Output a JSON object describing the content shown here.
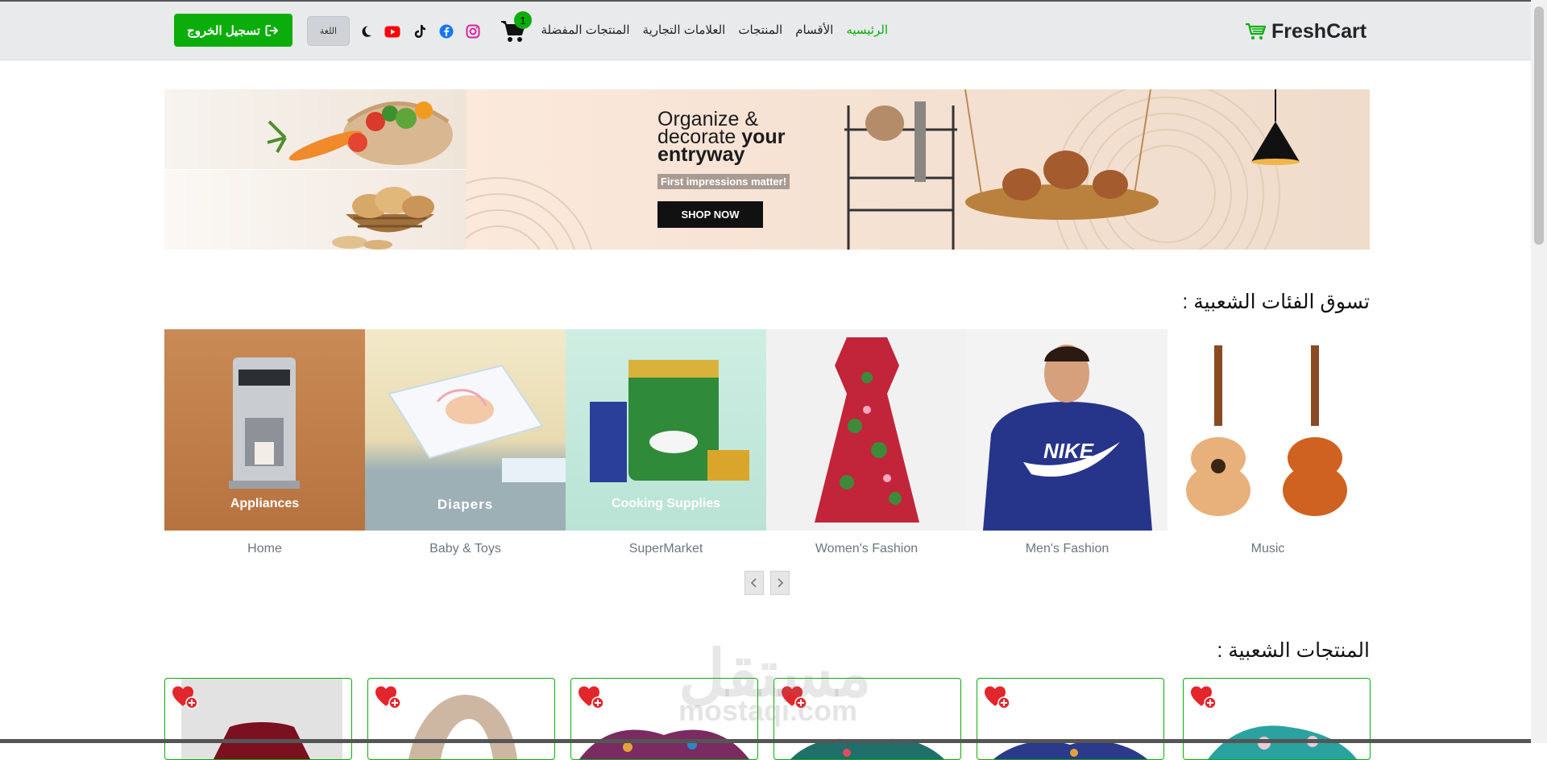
{
  "brand": {
    "name": "FreshCart",
    "icon": "cart-icon",
    "color": "#0aad0a"
  },
  "nav": {
    "links": [
      {
        "label": "الرئيسيه",
        "active": true
      },
      {
        "label": "الأقسام"
      },
      {
        "label": "المنتجات"
      },
      {
        "label": "العلامات التجارية"
      },
      {
        "label": "المنتجات المفضلة"
      }
    ],
    "cart_count": "1",
    "social_icons": [
      "instagram-icon",
      "facebook-icon",
      "tiktok-icon",
      "youtube-icon",
      "moon-icon"
    ],
    "language_label": "اللغة",
    "logout_label": "تسجيل الخروج"
  },
  "banner": {
    "title_line1": "Organize &",
    "title_line2a": "decorate",
    "title_line2b": "your",
    "title_line3": "entryway",
    "subtitle": "First impressions matter!",
    "button": "SHOP NOW"
  },
  "categories_section": {
    "title": "تسوق الفئات الشعبية :",
    "items": [
      {
        "image_caption": "Appliances",
        "name": "Home"
      },
      {
        "image_caption": "Diapers",
        "name": "Baby & Toys"
      },
      {
        "image_caption": "Cooking Supplies",
        "name": "SuperMarket"
      },
      {
        "image_caption": "",
        "name": "Women's Fashion"
      },
      {
        "image_caption": "NIKE",
        "name": "Men's Fashion"
      },
      {
        "image_caption": "",
        "name": "Music"
      }
    ]
  },
  "products_section": {
    "title": "المنتجات الشعبية :"
  },
  "watermark": {
    "arabic": "مستقل",
    "latin": "mostaqi.com"
  },
  "colors": {
    "accent": "#0aad0a",
    "heart": "#e3262b",
    "navbar_bg": "#e9eaec"
  }
}
